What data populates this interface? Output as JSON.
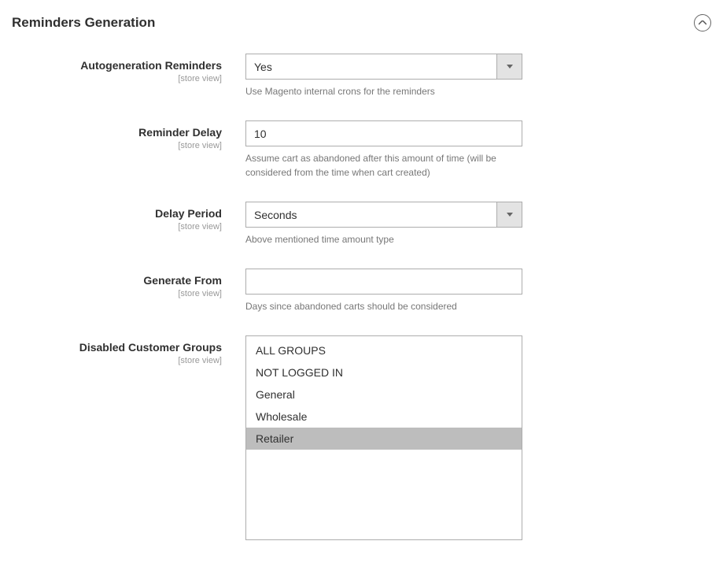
{
  "section": {
    "title": "Reminders Generation",
    "scope_label": "[store view]"
  },
  "fields": {
    "autogeneration": {
      "label": "Autogeneration Reminders",
      "value": "Yes",
      "help": "Use Magento internal crons for the reminders"
    },
    "reminder_delay": {
      "label": "Reminder Delay",
      "value": "10",
      "help": "Assume cart as abandoned after this amount of time (will be considered from the time when cart created)"
    },
    "delay_period": {
      "label": "Delay Period",
      "value": "Seconds",
      "help": "Above mentioned time amount type"
    },
    "generate_from": {
      "label": "Generate From",
      "value": "",
      "help": "Days since abandoned carts should be considered"
    },
    "disabled_groups": {
      "label": "Disabled Customer Groups",
      "options": [
        "ALL GROUPS",
        "NOT LOGGED IN",
        "General",
        "Wholesale",
        "Retailer"
      ],
      "selected_index": 4
    }
  }
}
